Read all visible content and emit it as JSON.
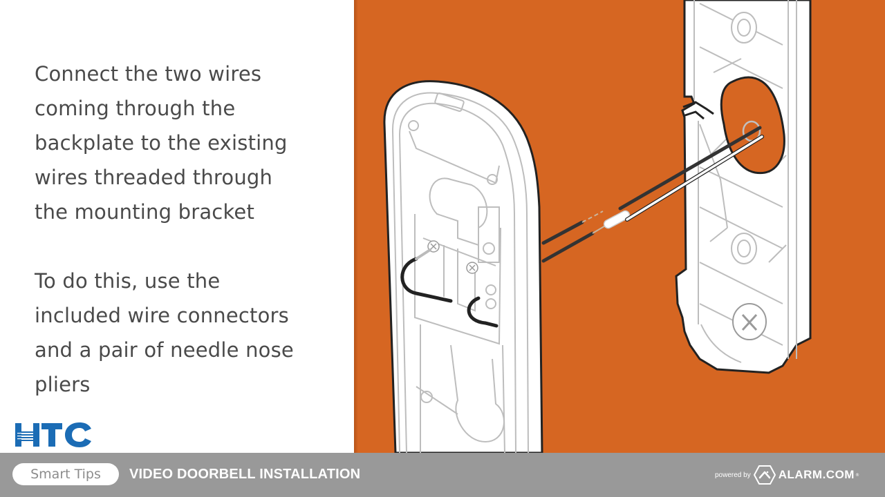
{
  "instructions": {
    "paragraph1": "Connect the two wires\ncoming through the\nbackplate to the existing\nwires threaded through\nthe mounting bracket",
    "paragraph2": "To do this, use the\nincluded wire connectors\nand a pair of needle nose\npliers"
  },
  "logo": {
    "name": "HTC",
    "icon": "htc-logo",
    "color": "#1b6cb5"
  },
  "illustration": {
    "description": "Video doorbell backplate with wires connected to mounting bracket",
    "background_color": "#d66622",
    "wire_colors": {
      "dark": "#333333",
      "light": "#ffffff"
    }
  },
  "footer": {
    "badge": "Smart Tips",
    "title": "VIDEO DOORBELL INSTALLATION",
    "powered_by": "powered by",
    "brand": "ALARM.COM",
    "brand_icon": "alarm-com-logo-icon",
    "background_color": "#999999"
  }
}
